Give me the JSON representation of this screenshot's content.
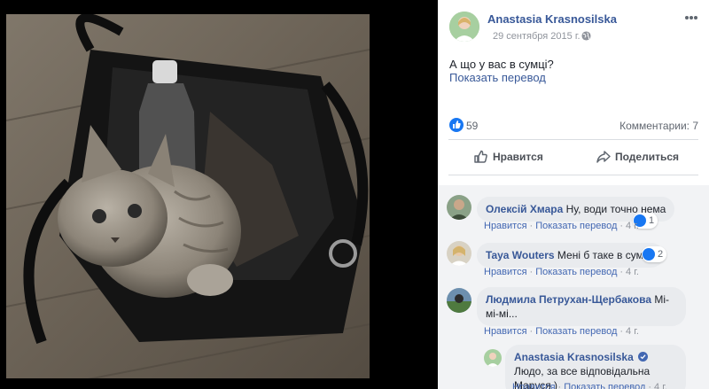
{
  "post": {
    "author": "Anastasia Krasnosilska",
    "date": "29 сентября 2015 г.",
    "text": "А що у вас в сумці?",
    "translate": "Показать перевод",
    "likes": "59",
    "comments_summary": "Комментарии: 7"
  },
  "actions": {
    "like": "Нравится",
    "share": "Поделиться"
  },
  "comment_actions": {
    "like": "Нравится",
    "translate": "Показать перевод"
  },
  "comments": [
    {
      "name": "Олексій Хмара",
      "text": "Ну, води точно нема",
      "age": "4 г.",
      "reactions": "1"
    },
    {
      "name": "Taya Wouters",
      "text": "Мені б таке в сумці)",
      "age": "4 г.",
      "reactions": "2"
    },
    {
      "name": "Людмила Петрухан-Щербакова",
      "text": "Мі-мі-мі...",
      "age": "4 г."
    },
    {
      "name": "Anastasia Krasnosilska",
      "text": "Людо, за все відповідальна Маруся )",
      "age": "4 г."
    }
  ]
}
